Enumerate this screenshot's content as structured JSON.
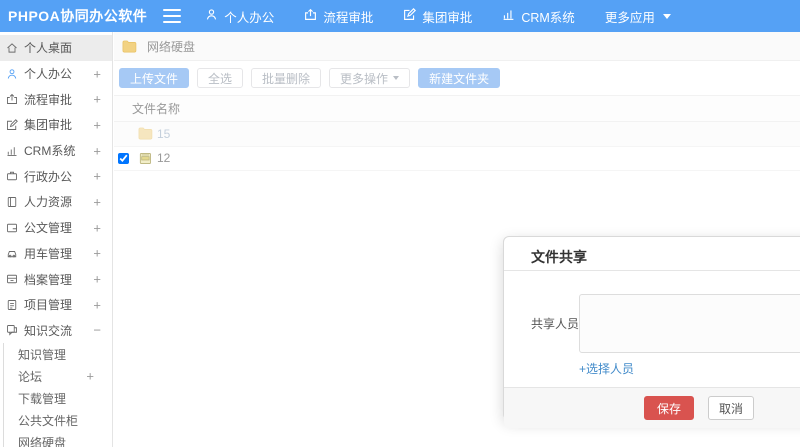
{
  "header": {
    "logo": "PHPOA协同办公软件",
    "nav": [
      {
        "label": "个人办公",
        "icon": "user-icon"
      },
      {
        "label": "流程审批",
        "icon": "share-icon"
      },
      {
        "label": "集团审批",
        "icon": "edit-icon"
      },
      {
        "label": "CRM系统",
        "icon": "chart-icon"
      },
      {
        "label": "更多应用",
        "icon": "caret-down-icon"
      }
    ]
  },
  "sidebar": {
    "items": [
      {
        "label": "个人桌面",
        "icon": "home-icon",
        "expander": "",
        "active": true
      },
      {
        "label": "个人办公",
        "icon": "user-icon",
        "expander": "+"
      },
      {
        "label": "流程审批",
        "icon": "share-icon",
        "expander": "+"
      },
      {
        "label": "集团审批",
        "icon": "edit-icon",
        "expander": "+"
      },
      {
        "label": "CRM系统",
        "icon": "chart-icon",
        "expander": "+"
      },
      {
        "label": "行政办公",
        "icon": "briefcase-icon",
        "expander": "+"
      },
      {
        "label": "人力资源",
        "icon": "book-icon",
        "expander": "+"
      },
      {
        "label": "公文管理",
        "icon": "document-icon",
        "expander": "+"
      },
      {
        "label": "用车管理",
        "icon": "car-icon",
        "expander": "+"
      },
      {
        "label": "档案管理",
        "icon": "archive-icon",
        "expander": "+"
      },
      {
        "label": "项目管理",
        "icon": "clipboard-icon",
        "expander": "+"
      },
      {
        "label": "知识交流",
        "icon": "chat-icon",
        "expander": "−",
        "expanded": true
      }
    ],
    "subitems": [
      {
        "label": "知识管理",
        "expander": ""
      },
      {
        "label": "论坛",
        "expander": "+"
      },
      {
        "label": "下载管理",
        "expander": ""
      },
      {
        "label": "公共文件柜",
        "expander": ""
      },
      {
        "label": "网络硬盘",
        "expander": ""
      }
    ]
  },
  "main": {
    "breadcrumb": "网络硬盘",
    "toolbar": {
      "upload": "上传文件",
      "select_all": "全选",
      "batch_delete": "批量删除",
      "more_ops": "更多操作",
      "new_folder": "新建文件夹"
    },
    "table": {
      "name_header": "文件名称",
      "rows": [
        {
          "name": "15",
          "type": "folder",
          "faded": true,
          "checked": false
        },
        {
          "name": "12",
          "type": "archive",
          "faded": false,
          "checked": true
        }
      ]
    }
  },
  "modal": {
    "title": "文件共享",
    "share_label": "共享人员",
    "share_value": "",
    "select_link": "+选择人员",
    "save": "保存",
    "cancel": "取消"
  },
  "colors": {
    "topbar_blue": "#55a1f5",
    "primary_button_blue": "#a6c9f5",
    "save_red": "#d9534f",
    "link_blue": "#428bca",
    "folder_yellow": "#f2d283",
    "active_item_bg": "#ececec"
  }
}
